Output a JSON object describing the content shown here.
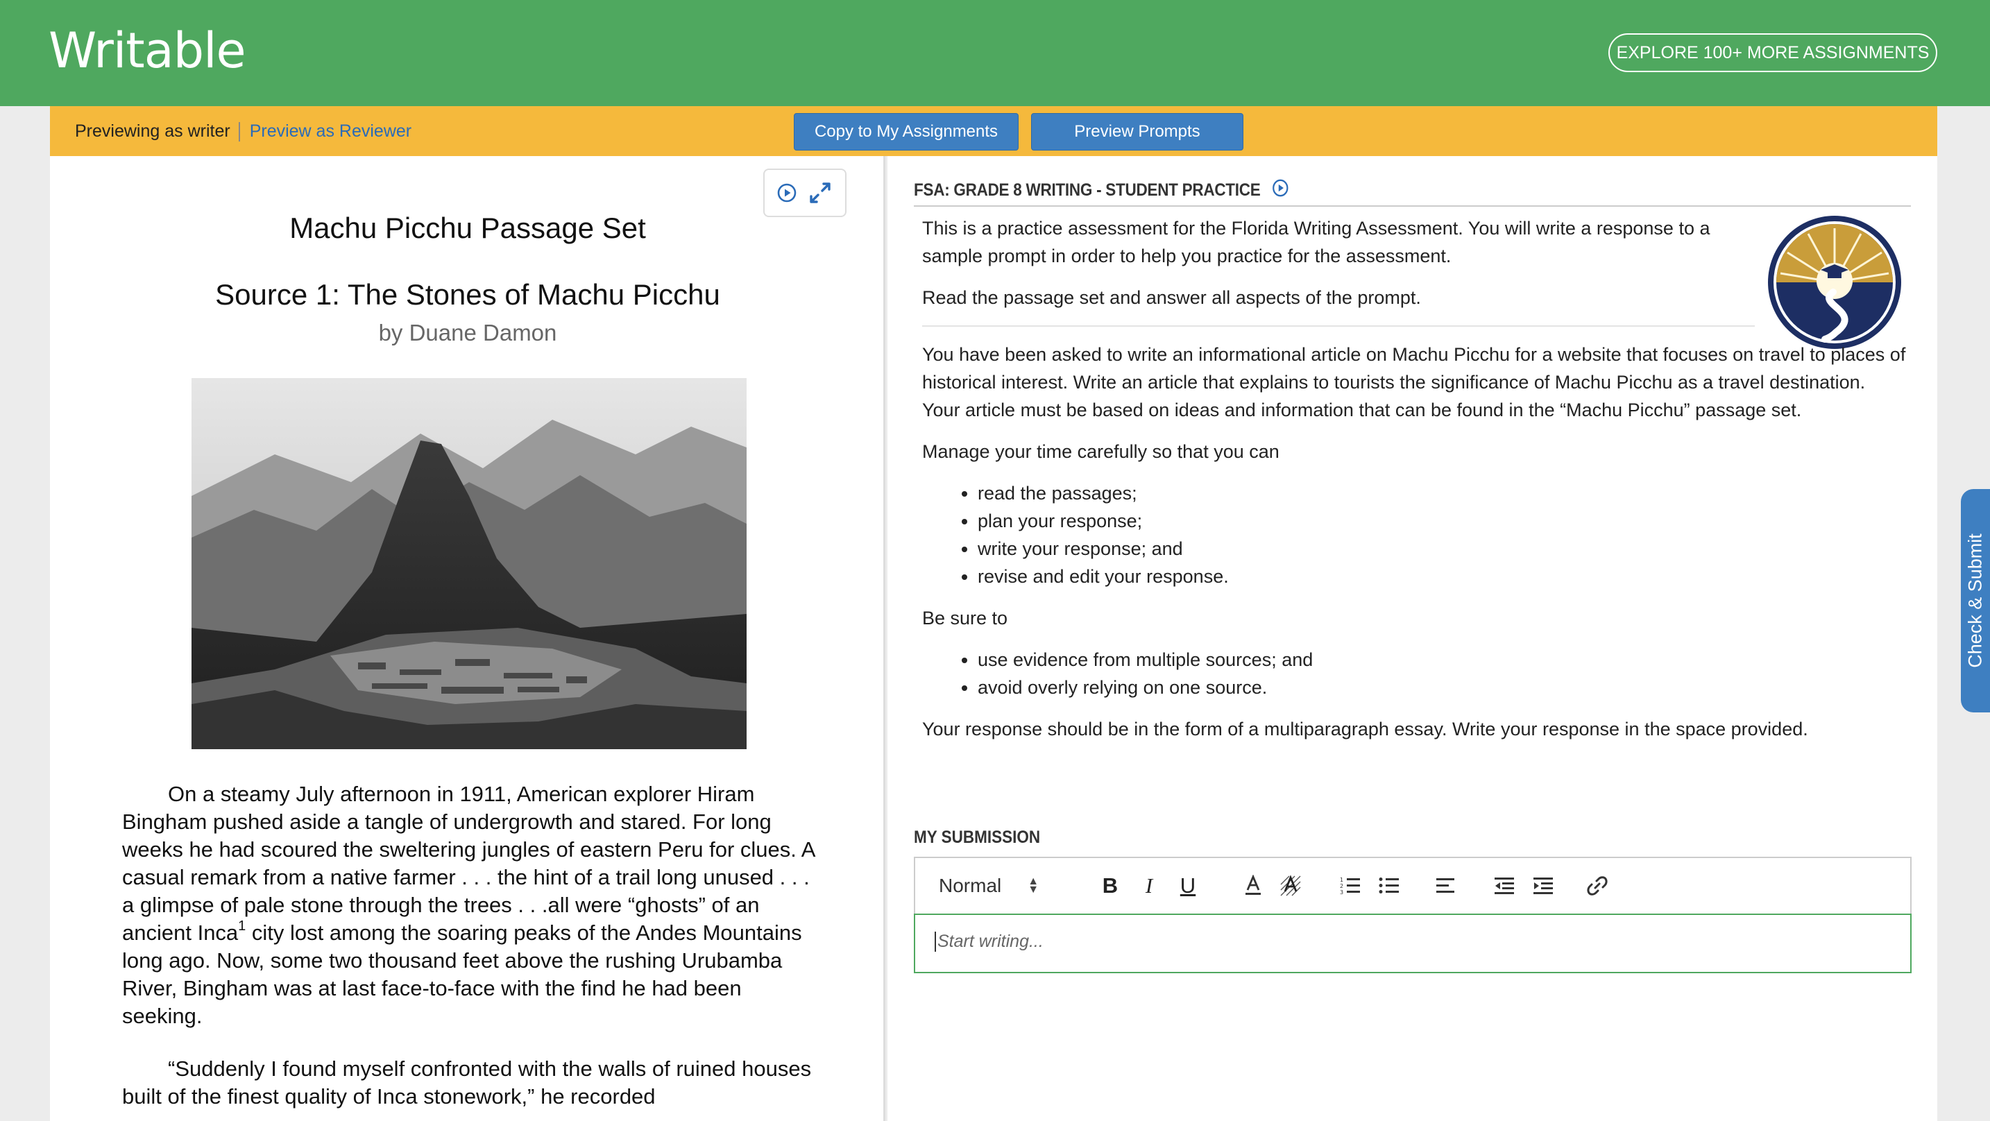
{
  "header": {
    "logo": "Writable",
    "explore_label": "EXPLORE 100+ MORE ASSIGNMENTS"
  },
  "preview_bar": {
    "mode_label": "Previewing as writer",
    "reviewer_link": "Preview as Reviewer",
    "copy_label": "Copy to My Assignments",
    "prompts_label": "Preview Prompts"
  },
  "passage": {
    "set_title": "Machu Picchu Passage Set",
    "source_title": "Source 1: The Stones of Machu Picchu",
    "author": "by Duane Damon",
    "image_icon": "machu-picchu-photo",
    "p1_a": "On a steamy July afternoon in 1911, American explorer Hiram Bingham pushed aside a tangle of undergrowth and stared. For long weeks he had scoured the sweltering jungles of eastern Peru for clues. A casual remark from a native farmer . . . the hint of a trail long unused . . . a glimpse of pale stone through the trees . . .all were “ghosts” of an ancient Inca",
    "p1_sup": "1",
    "p1_b": " city lost among the soaring peaks of the Andes Mountains long ago. Now, some two thousand feet above the rushing Urubamba River, Bingham was at last face-to-face with the find he had been seeking.",
    "p2": "“Suddenly I found myself confronted with the walls of ruined houses built of the finest quality of Inca stonework,” he recorded"
  },
  "assignment": {
    "section_title": "FSA: GRADE 8 WRITING - STUDENT PRACTICE",
    "intro1": "This is a practice assessment for the Florida Writing Assessment. You will write a response to a sample prompt in order to help you practice for the assessment.",
    "intro2": "Read the passage set and answer all aspects of the prompt.",
    "task": "You have been asked to write an informational article on Machu Picchu for a website that focuses on travel to places of historical interest. Write an article that explains to tourists the significance of Machu Picchu as a travel destination. Your article must be based on ideas and information that can be found in the “Machu Picchu” passage set.",
    "manage_label": "Manage your time carefully so that you can",
    "manage_items": [
      "read the passages;",
      "plan your response;",
      "write your response; and",
      "revise and edit your response."
    ],
    "besure_label": "Be sure to",
    "besure_items": [
      "use evidence from multiple sources; and",
      "avoid overly relying on one source."
    ],
    "form_note": "Your response should be in the form of a multiparagraph essay. Write your response in the space provided."
  },
  "submission": {
    "title": "MY SUBMISSION",
    "format_value": "Normal",
    "bold": "B",
    "italic": "I",
    "underline": "U",
    "placeholder": "Start writing..."
  },
  "side_tab": {
    "label": "Check & Submit"
  },
  "colors": {
    "header_green": "#4fa85f",
    "preview_bar": "#f5b93c",
    "button_blue": "#3e7fc1",
    "editor_border": "#4fa85f"
  }
}
